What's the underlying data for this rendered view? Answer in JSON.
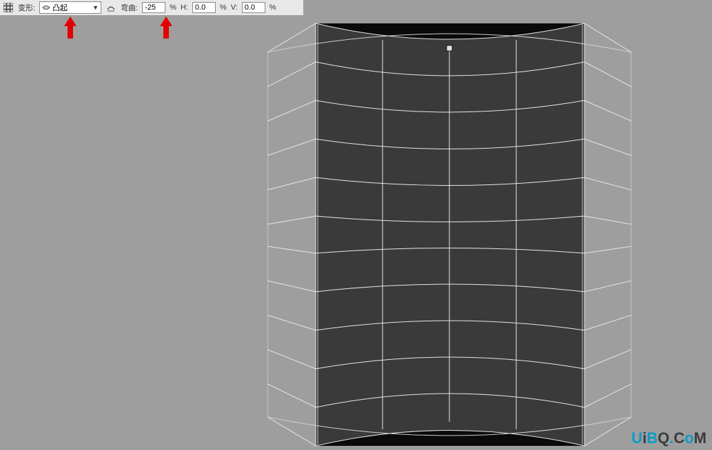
{
  "toolbar": {
    "warp_label": "变形:",
    "warp_style": "凸起",
    "orientation_label": "弯曲:",
    "bend_value": "-25",
    "h_label": "H:",
    "h_value": "0.0",
    "v_label": "V:",
    "v_value": "0.0",
    "percent": "%"
  },
  "watermark": "UiBQ.CoM",
  "chart_data": {
    "type": "other",
    "description": "Photoshop warp transform grid with Bulge style at -25% bend, creating concave vertical cylinder distortion on a dark rectangular layer. Grid is 6 columns × 11 rows of warp cells.",
    "grid_cols": 6,
    "grid_rows": 11,
    "bend_percent": -25,
    "h_distortion": 0.0,
    "v_distortion": 0.0
  }
}
